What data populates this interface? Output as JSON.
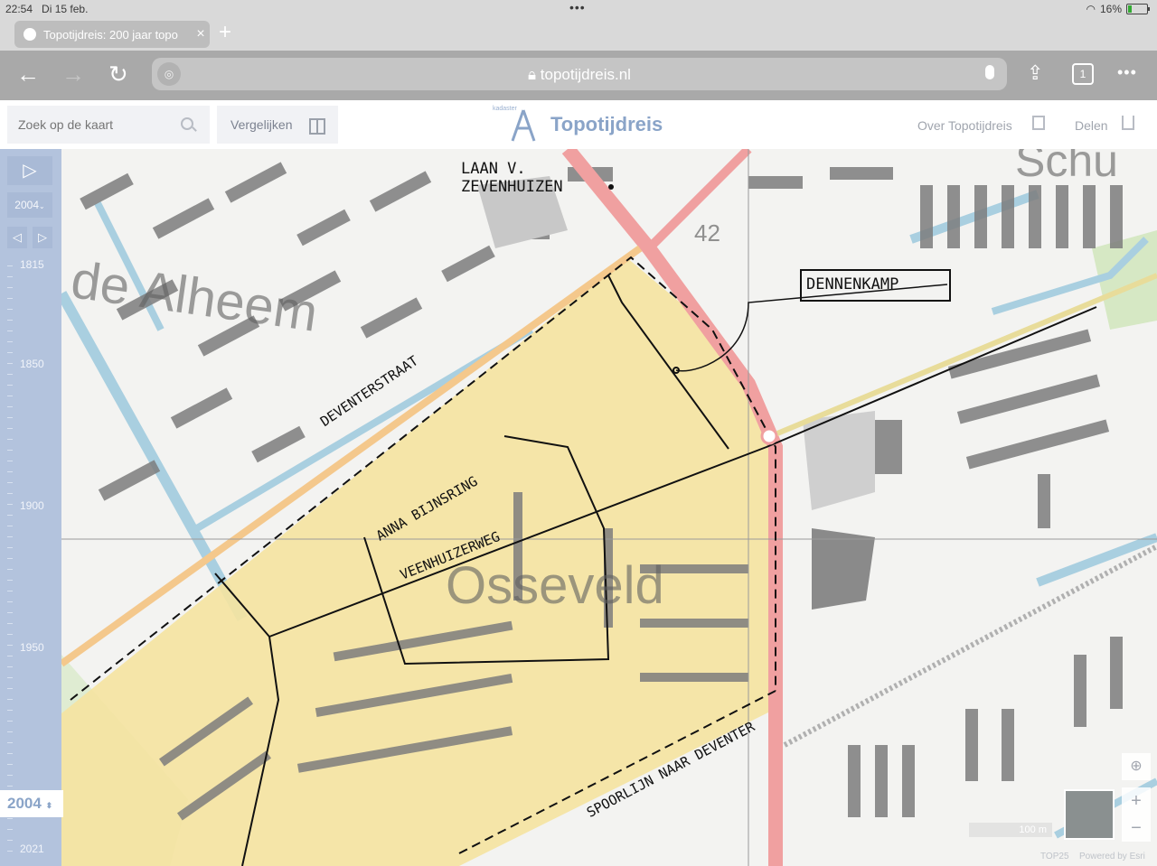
{
  "status_bar": {
    "time": "22:54",
    "date": "Di 15 feb.",
    "battery": "16%",
    "battery_level": 0.16
  },
  "tab": {
    "title": "Topotijdreis: 200 jaar topo",
    "close": "×"
  },
  "nav": {
    "url": "topotijdreis.nl",
    "tabs_count": "1"
  },
  "app": {
    "search_placeholder": "Zoek op de kaart",
    "compare_label": "Vergelijken",
    "brand_sub": "kadaster",
    "brand_name": "Topotijdreis",
    "about_label": "Over Topotijdreis",
    "share_label": "Delen"
  },
  "timeline": {
    "selected_year": "2004",
    "labels": [
      "1815",
      "1850",
      "1900",
      "1950",
      "2021"
    ],
    "current_year": "2004"
  },
  "map": {
    "place_labels": [
      "de Alheem",
      "Osseveld",
      "Schu"
    ],
    "road_number": "42",
    "annotations": [
      "LAAN V. ZEVENHUIZEN",
      "DENNENKAMP",
      "DEVENTERSTRAAT",
      "ANNA BIJNSRING",
      "VEENHUIZERWEG",
      "SPOORLIJN NAAR DEVENTER"
    ],
    "colors": {
      "highlight": "#f5e3a0",
      "road": "#f0a0a0",
      "water": "#a9cfe0",
      "green": "#d6e8c4",
      "building": "#7c7c7c"
    }
  },
  "controls": {
    "scale": "100 m",
    "zoom_in": "+",
    "zoom_out": "−"
  },
  "attribution": {
    "source": "TOP25",
    "powered": "Powered by Esri"
  }
}
